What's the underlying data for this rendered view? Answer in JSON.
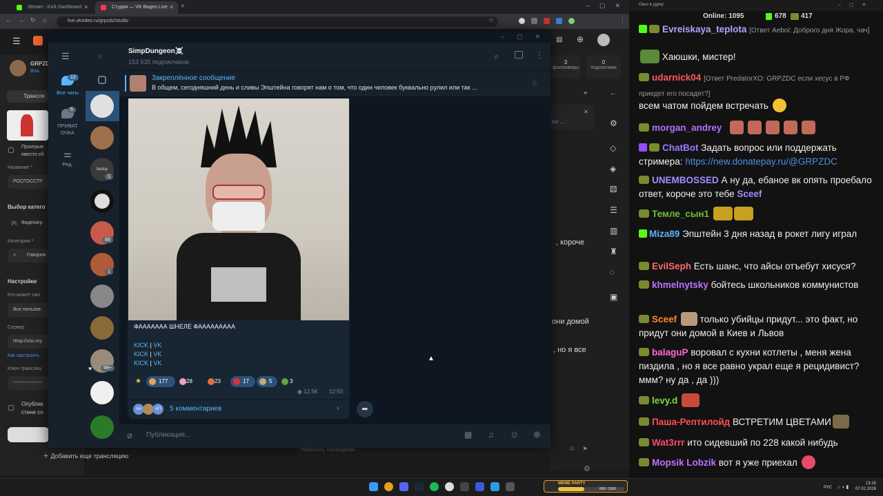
{
  "browser": {
    "tabs": [
      {
        "label": "Stream - Kick Dashboard",
        "color": "#53fc18"
      },
      {
        "label": "Студия — VK Видео Live",
        "color": "#ff3355"
      }
    ],
    "url": "live.vkvideo.ru/grpzdc/studio",
    "new_tab": "+"
  },
  "studio": {
    "channel_short": "GRPZDC",
    "channel_sub": "Вла",
    "tab_translation": "Трансля",
    "stream_checkbox": "Проигрыв вместо об",
    "name_label": "Название *",
    "name_value": "РОСГОССТР",
    "category_section": "Выбор катего",
    "category_game": "Видеоигр",
    "category_label": "Категория *",
    "category_value": "Говорим",
    "settings_title": "Настройки",
    "who_label": "Кто может смо",
    "who_value": "Все пользов",
    "server_label": "Сервер",
    "server_value": "rtmp://vsu.my",
    "howto": "Как настроить",
    "key_label": "Ключ трансляц",
    "key_value": "------------------",
    "publish_text": "Опублик стене со",
    "add_stream": "Добавить еще трансляцию",
    "followers_count": "3",
    "followers_label": "фолловеры",
    "subs_count": "0",
    "subs_label": "подписчики",
    "chat_snip1": ", короче",
    "chat_snip2": "они домой",
    "chat_snip3": ", но я все",
    "chat_placeholder": "Написать сообщение",
    "chat_bot": "bot ,..."
  },
  "telegram": {
    "folders": [
      {
        "label": "Все чаты",
        "badge": "12"
      },
      {
        "label": "ПРИВАТ ОЧКА",
        "badge": "5"
      },
      {
        "label": "Ред.",
        "badge": ""
      }
    ],
    "chat_badges": [
      "1",
      "69",
      "1",
      "99+"
    ],
    "chat_label_toolsy": "toolsy",
    "channel_name": "SimpDungeon☠️",
    "channel_subs": "153 635 подписчиков",
    "pinned_title": "Закреплённое сообщение",
    "pinned_text": "В общем, сегодняшний день и сливы Эпштейна говорят нам о том, что один человек буквально рулил или так ...",
    "post_text": "ФААААААА ШНЕЛЕ ФААААААААА",
    "links": [
      {
        "a": "KICK",
        "sep": " | ",
        "b": "VK"
      },
      {
        "a": "KICK",
        "sep": " | ",
        "b": "VK"
      },
      {
        "a": "KICK",
        "sep": " | ",
        "b": "VK"
      }
    ],
    "reactions": [
      {
        "count": "177",
        "color": "#e8a25a"
      },
      {
        "count": "28",
        "color": "#f0a0c0"
      },
      {
        "count": "23",
        "color": "#e07040"
      },
      {
        "count": "17",
        "color": "#e0303a"
      },
      {
        "count": "5",
        "color": "#c8a878"
      },
      {
        "count": "3",
        "color": "#6aa040"
      }
    ],
    "views": "12.5K",
    "time": "12:50",
    "comments": "5 комментариев",
    "commenters": [
      "AA",
      "AП"
    ],
    "input_placeholder": "Публикация..."
  },
  "chat_panel": {
    "window_title": "Окно в дурку",
    "online_label": "Online:",
    "online_count": "1095",
    "kick_count": "678",
    "vk_count": "417",
    "messages": [
      {
        "user": "Evreiskaya_teplota",
        "color": "#b8a0ff",
        "platform": "kick",
        "reply": "[Ответ Aeboi: Доброго дня Жора, чач]",
        "text": ""
      },
      {
        "user": "",
        "color": "#ffffff",
        "platform": "none",
        "reply": "",
        "text": "Хаюшки, мистер!"
      },
      {
        "user": "udarnick04",
        "color": "#ff5a5a",
        "platform": "vk",
        "reply": "[Ответ PredatorXO: GRPZDC если хесус в РФ приедет его посадят?]",
        "text": ""
      },
      {
        "user": "",
        "color": "#ffffff",
        "platform": "none",
        "reply": "",
        "text": "всем чатом пойдем встречать"
      },
      {
        "user": "morgan_andrey",
        "color": "#b070ff",
        "platform": "vk",
        "reply": "",
        "text": ""
      },
      {
        "user": "ChatBot",
        "color": "#9a7bff",
        "platform": "kick",
        "reply": "",
        "text": "Задать вопрос или поддержать стримера:",
        "link": "https://new.donatepay.ru/@GRPZDC"
      },
      {
        "user": "UNEMBOSSED",
        "color": "#a68bff",
        "platform": "vk",
        "reply": "",
        "text": "А ну да, ебаное вк опять проебало ответ, короче это тебе",
        "mention": "Sceef"
      },
      {
        "user": "Темле_сын1",
        "color": "#6fbf3a",
        "platform": "vk",
        "reply": "",
        "text": ""
      },
      {
        "user": "Miza89",
        "color": "#5ab4ff",
        "platform": "kick",
        "reply": "",
        "text": "Эпштейн 3 дня назад в рокет лигу играл"
      },
      {
        "user": "EvilSeph",
        "color": "#ff6b6b",
        "platform": "vk",
        "reply": "",
        "text": "Есть шанс, что айсы отъебут хисуся?"
      },
      {
        "user": "khmelnytsky",
        "color": "#c070ff",
        "platform": "vk",
        "reply": "",
        "text": "бойтесь школьников коммунистов"
      },
      {
        "user": "Sceef",
        "color": "#ff8a2a",
        "platform": "vk",
        "reply": "",
        "text": "только убийцы придут... это факт, но придут они домой в Киев и Львов"
      },
      {
        "user": "balaguP",
        "color": "#ff6ad5",
        "platform": "vk",
        "reply": "",
        "text": "воровал с кухни котлеты , меня жена пиздила , но я все равно украл еще я рецидивист? ммм? ну да , да )))"
      },
      {
        "user": "levy.d",
        "color": "#7ddc3a",
        "platform": "vk",
        "reply": "",
        "text": ""
      },
      {
        "user": "Паша-Рептилойд",
        "color": "#ff5050",
        "platform": "vk",
        "reply": "",
        "text": "ВСТРЕТИМ ЦВЕТАМИ"
      },
      {
        "user": "Wat3rrr",
        "color": "#ff4a6a",
        "platform": "vk",
        "reply": "",
        "text": "ито сидевший по 228 какой нибудь"
      },
      {
        "user": "Mopsik Lobzik",
        "color": "#c070ff",
        "platform": "vk",
        "reply": "",
        "text": "вот я уже приехал"
      }
    ]
  },
  "taskbar": {
    "widget_title": "MEME PARTY",
    "widget_progress": "600 / 1500",
    "widget_fraction": 0.4,
    "lang": "РУС",
    "time": "13:15",
    "date": "07.02.2026"
  }
}
